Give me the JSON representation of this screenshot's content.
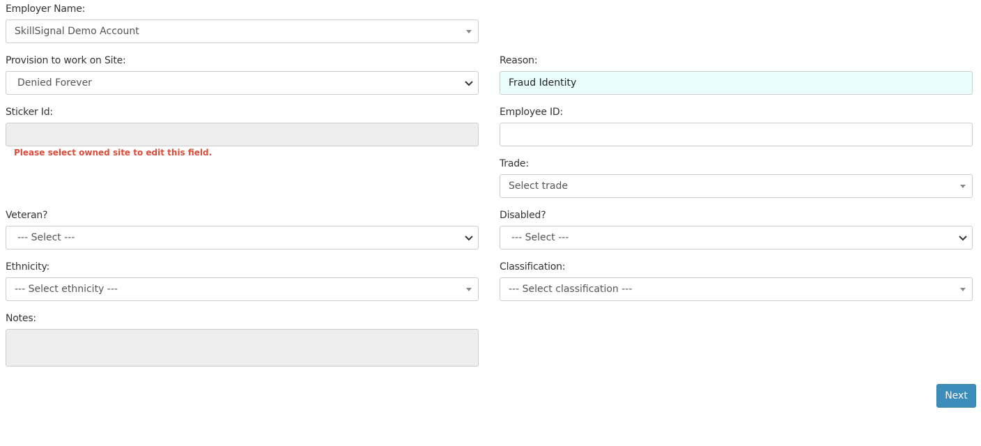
{
  "employer": {
    "label": "Employer Name:",
    "value": "SkillSignal Demo Account"
  },
  "provision": {
    "label": "Provision to work on Site:",
    "value": "Denied Forever"
  },
  "reason": {
    "label": "Reason:",
    "value": "Fraud Identity"
  },
  "sticker": {
    "label": "Sticker Id:",
    "value": "",
    "error": "Please select owned site to edit this field."
  },
  "employee_id": {
    "label": "Employee ID:",
    "value": ""
  },
  "trade": {
    "label": "Trade:",
    "value": "Select trade"
  },
  "veteran": {
    "label": "Veteran?",
    "value": "--- Select ---"
  },
  "disabled": {
    "label": "Disabled?",
    "value": "--- Select ---"
  },
  "ethnicity": {
    "label": "Ethnicity:",
    "value": "--- Select ethnicity ---"
  },
  "classification": {
    "label": "Classification:",
    "value": "--- Select classification ---"
  },
  "notes": {
    "label": "Notes:",
    "value": ""
  },
  "next_button": "Next",
  "colors": {
    "primary": "#3c8dbc",
    "error": "#dd4b39",
    "highlight": "#ebfefe",
    "disabled_bg": "#eeeeee"
  }
}
